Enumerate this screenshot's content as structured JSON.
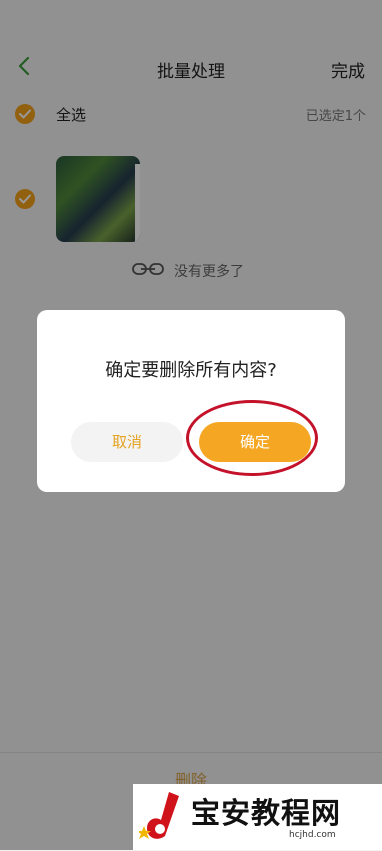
{
  "header": {
    "title": "批量处理",
    "done_label": "完成"
  },
  "selection": {
    "select_all_label": "全选",
    "selected_count": "已选定1个"
  },
  "list": {
    "end_text": "没有更多了"
  },
  "bottom": {
    "delete_label": "删除"
  },
  "dialog": {
    "message": "确定要删除所有内容?",
    "cancel_label": "取消",
    "confirm_label": "确定"
  },
  "watermark": {
    "title": "宝安教程网",
    "url": "hcjhd.com"
  },
  "colors": {
    "accent": "#f5a623",
    "back_arrow": "#3d9a3d",
    "highlight": "#c4122a"
  }
}
